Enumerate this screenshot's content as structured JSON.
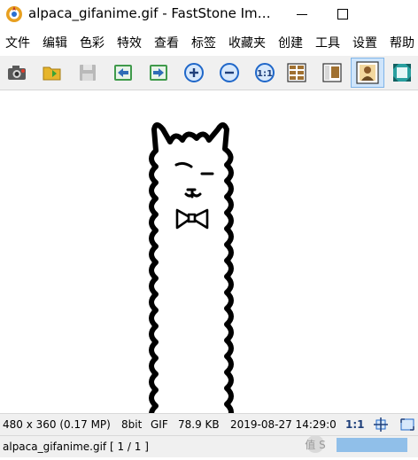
{
  "window": {
    "title": "alpaca_gifanime.gif - FastStone Im…",
    "minimize_icon": "minimize-icon",
    "maximize_icon": "maximize-icon"
  },
  "menu": [
    "文件",
    "编辑",
    "色彩",
    "特效",
    "查看",
    "标签",
    "收藏夹",
    "创建",
    "工具",
    "设置",
    "帮助"
  ],
  "toolbar": {
    "buttons": [
      "camera-icon",
      "open-folder-icon",
      "save-icon",
      "previous-icon",
      "next-icon",
      "zoom-in-icon",
      "zoom-out-icon",
      "actual-size-icon",
      "thumbnails-icon",
      "single-page-icon",
      "fullscreen-image-icon",
      "fit-window-icon"
    ],
    "active": "fullscreen-image-icon"
  },
  "status": {
    "dimensions": "480 x 360 (0.17 MP)",
    "bitdepth": "8bit",
    "format": "GIF",
    "filesize": "78.9 KB",
    "datetime": "2019-08-27 14:29:0",
    "zoom": "1:1",
    "filename": "alpaca_gifanime.gif [ 1 / 1 ]"
  },
  "watermark_text": "值 S"
}
